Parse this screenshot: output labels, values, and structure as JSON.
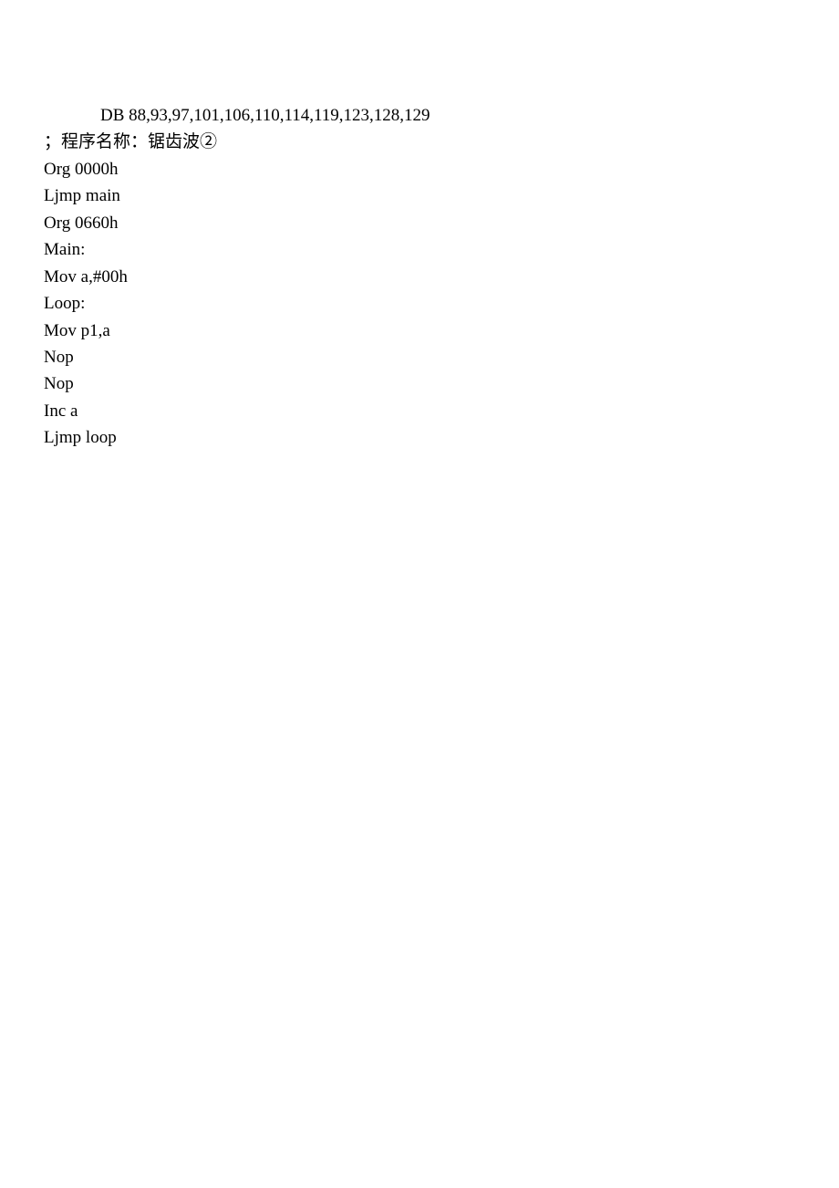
{
  "lines": [
    {
      "text": "DB 88,93,97,101,106,110,114,119,123,128,129",
      "indent": true
    },
    {
      "text": "；程序名称：锯齿波②",
      "indent": false
    },
    {
      "text": "Org 0000h",
      "indent": false
    },
    {
      "text": "Ljmp main",
      "indent": false
    },
    {
      "text": "Org 0660h",
      "indent": false
    },
    {
      "text": "Main:",
      "indent": false
    },
    {
      "text": "Mov a,#00h",
      "indent": false
    },
    {
      "text": "Loop:",
      "indent": false
    },
    {
      "text": "Mov p1,a",
      "indent": false
    },
    {
      "text": "Nop",
      "indent": false
    },
    {
      "text": "Nop",
      "indent": false
    },
    {
      "text": "Inc a",
      "indent": false
    },
    {
      "text": "Ljmp loop",
      "indent": false
    }
  ]
}
